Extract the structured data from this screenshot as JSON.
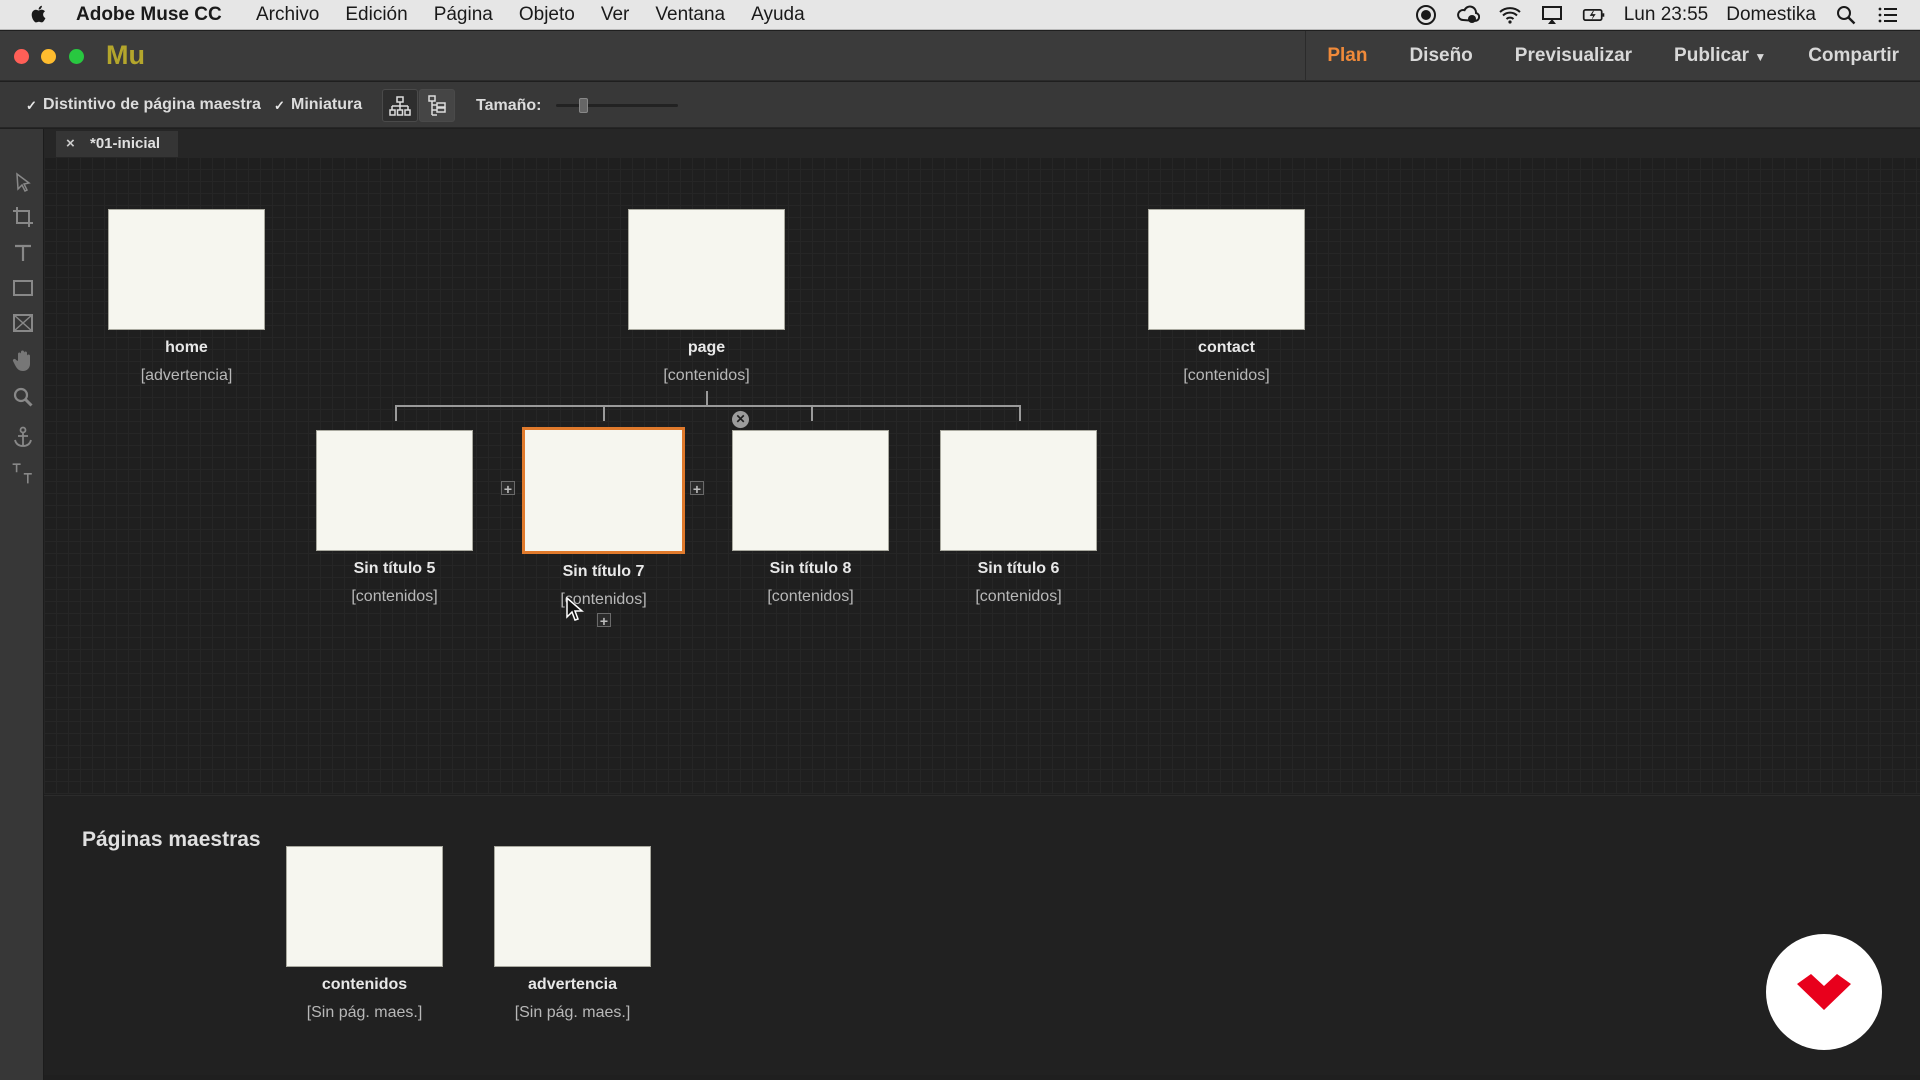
{
  "menubar": {
    "app_name": "Adobe Muse CC",
    "menus": [
      "Archivo",
      "Edición",
      "Página",
      "Objeto",
      "Ver",
      "Ventana",
      "Ayuda"
    ],
    "clock": "Lun 23:55",
    "user": "Domestika"
  },
  "app": {
    "logo": "Mu",
    "modes": {
      "plan": "Plan",
      "design": "Diseño",
      "preview": "Previsualizar",
      "publish": "Publicar",
      "share": "Compartir"
    }
  },
  "toolbar": {
    "master_badge_label": "Distintivo de página maestra",
    "thumbnail_label": "Miniatura",
    "size_label": "Tamaño:",
    "size_level": 0.2
  },
  "document_tab": {
    "close": "×",
    "title": "*01-inicial"
  },
  "sitemap": {
    "top_level": [
      {
        "name": "home",
        "master": "[advertencia]"
      },
      {
        "name": "page",
        "master": "[contenidos]"
      },
      {
        "name": "contact",
        "master": "[contenidos]"
      }
    ],
    "children_of_page": [
      {
        "name": "Sin título 5",
        "master": "[contenidos]"
      },
      {
        "name": "Sin título 7",
        "master": "[contenidos]",
        "selected": true
      },
      {
        "name": "Sin título 8",
        "master": "[contenidos]"
      },
      {
        "name": "Sin título 6",
        "master": "[contenidos]"
      }
    ]
  },
  "masters_panel": {
    "title": "Páginas maestras",
    "pages": [
      {
        "name": "contenidos",
        "master": "[Sin pág. maes.]"
      },
      {
        "name": "advertencia",
        "master": "[Sin pág. maes.]"
      }
    ]
  },
  "colors": {
    "accent": "#f08a3a",
    "selection": "#e07a2c",
    "logo": "#b4a62c",
    "badge": "#e8001c"
  }
}
